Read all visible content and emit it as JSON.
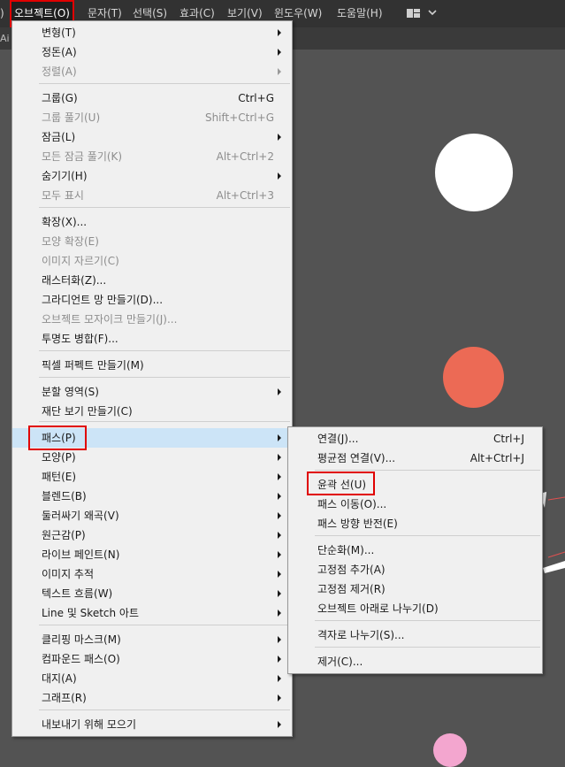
{
  "menubar": {
    "left_fragment": ")",
    "items": [
      "오브젝트(O)",
      "문자(T)",
      "선택(S)",
      "효과(C)",
      "보기(V)",
      "윈도우(W)",
      "도움말(H)"
    ],
    "workspace_icon": "layout-grid-icon",
    "workspace_chevron": "chevron-down-icon"
  },
  "tabstrip": {
    "fragment": "Ai ("
  },
  "object_menu": [
    {
      "label": "변형(T)",
      "submenu": true
    },
    {
      "label": "정돈(A)",
      "submenu": true
    },
    {
      "label": "정렬(A)",
      "submenu": true,
      "disabled": true
    },
    {
      "label": "그룹(G)",
      "shortcut": "Ctrl+G"
    },
    {
      "label": "그룹 풀기(U)",
      "shortcut": "Shift+Ctrl+G",
      "disabled": true
    },
    {
      "label": "잠금(L)",
      "submenu": true
    },
    {
      "label": "모든 잠금 풀기(K)",
      "shortcut": "Alt+Ctrl+2",
      "disabled": true
    },
    {
      "label": "숨기기(H)",
      "submenu": true
    },
    {
      "label": "모두 표시",
      "shortcut": "Alt+Ctrl+3",
      "disabled": true
    },
    {
      "label": "확장(X)..."
    },
    {
      "label": "모양 확장(E)",
      "disabled": true
    },
    {
      "label": "이미지 자르기(C)",
      "disabled": true
    },
    {
      "label": "래스터화(Z)..."
    },
    {
      "label": "그라디언트 망 만들기(D)..."
    },
    {
      "label": "오브젝트 모자이크 만들기(J)...",
      "disabled": true
    },
    {
      "label": "투명도 병합(F)..."
    },
    {
      "label": "픽셀 퍼펙트 만들기(M)"
    },
    {
      "label": "분할 영역(S)",
      "submenu": true
    },
    {
      "label": "재단 보기 만들기(C)"
    },
    {
      "label": "패스(P)",
      "submenu": true,
      "highlighted": true
    },
    {
      "label": "모양(P)",
      "submenu": true
    },
    {
      "label": "패턴(E)",
      "submenu": true
    },
    {
      "label": "블렌드(B)",
      "submenu": true
    },
    {
      "label": "둘러싸기 왜곡(V)",
      "submenu": true
    },
    {
      "label": "원근감(P)",
      "submenu": true
    },
    {
      "label": "라이브 페인트(N)",
      "submenu": true
    },
    {
      "label": "이미지 추적",
      "submenu": true
    },
    {
      "label": "텍스트 흐름(W)",
      "submenu": true
    },
    {
      "label": "Line 및 Sketch 아트",
      "submenu": true
    },
    {
      "label": "클리핑 마스크(M)",
      "submenu": true
    },
    {
      "label": "컴파운드 패스(O)",
      "submenu": true
    },
    {
      "label": "대지(A)",
      "submenu": true
    },
    {
      "label": "그래프(R)",
      "submenu": true
    },
    {
      "label": "내보내기 위해 모으기",
      "submenu": true
    }
  ],
  "path_submenu": [
    {
      "label": "연결(J)...",
      "shortcut": "Ctrl+J"
    },
    {
      "label": "평균점 연결(V)...",
      "shortcut": "Alt+Ctrl+J"
    },
    {
      "label": "윤곽 선(U)"
    },
    {
      "label": "패스 이동(O)..."
    },
    {
      "label": "패스 방향 반전(E)"
    },
    {
      "label": "단순화(M)..."
    },
    {
      "label": "고정점 추가(A)"
    },
    {
      "label": "고정점 제거(R)"
    },
    {
      "label": "오브젝트 아래로 나누기(D)"
    },
    {
      "label": "격자로 나누기(S)..."
    },
    {
      "label": "제거(C)..."
    }
  ],
  "colors": {
    "canvas": "#535353",
    "menu_bg": "#f0f0f0",
    "highlight": "#cce4f7",
    "annotation_red": "#e00000",
    "shape_white": "#ffffff",
    "shape_coral": "#ec6a55",
    "shape_pink": "#f3a6cf"
  }
}
